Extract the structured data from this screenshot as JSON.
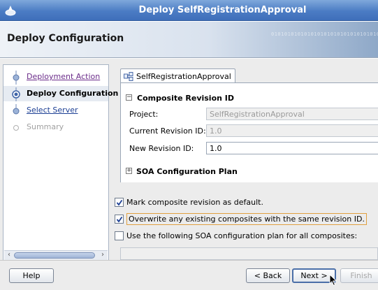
{
  "window": {
    "title": "Deploy SelfRegistrationApproval"
  },
  "header": {
    "heading": "Deploy Configuration",
    "decoration": "0101010101010101010101010101010101"
  },
  "nav": {
    "items": [
      {
        "label": "Deployment Action",
        "state": "done"
      },
      {
        "label": "Deploy Configuration",
        "state": "current"
      },
      {
        "label": "Select Server",
        "state": "link"
      },
      {
        "label": "Summary",
        "state": "future"
      }
    ]
  },
  "tab": {
    "label": "SelfRegistrationApproval",
    "icon": "composite-icon"
  },
  "composite_revision": {
    "title": "Composite Revision ID",
    "toggle": "−",
    "project_label": "Project:",
    "project_value": "SelfRegistrationApproval",
    "current_label": "Current Revision ID:",
    "current_value": "1.0",
    "new_label": "New Revision ID:",
    "new_value": "1.0"
  },
  "soa_plan": {
    "title": "SOA Configuration Plan",
    "toggle": "+"
  },
  "options": {
    "mark_default": {
      "label": "Mark composite revision as default.",
      "checked": true
    },
    "overwrite": {
      "label": "Overwrite any existing composites with the same revision ID.",
      "checked": true
    },
    "use_plan": {
      "label": "Use the following SOA configuration plan for all composites:",
      "checked": false
    }
  },
  "buttons": {
    "help": "Help",
    "back": "< Back",
    "next": "Next >",
    "finish": "Finish"
  },
  "colors": {
    "title_bar": "#4b7cc4",
    "visited_link": "#6b2c8a",
    "link": "#1c3f94",
    "focus": "#e0a040"
  }
}
